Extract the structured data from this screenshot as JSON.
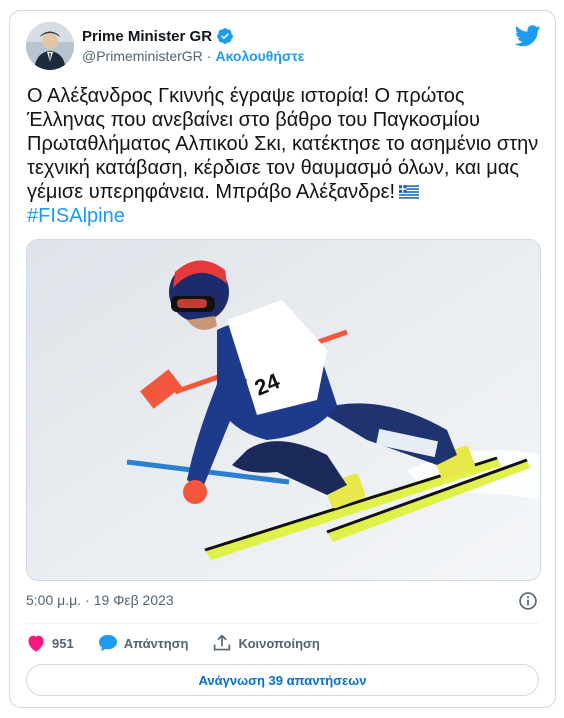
{
  "tweet": {
    "author_name": "Prime Minister GR",
    "author_handle": "@PrimeministerGR",
    "separator": "·",
    "follow_label": "Ακολουθήστε",
    "text": "Ο Αλέξανδρος Γκιννής έγραψε ιστορία! Ο πρώτος Έλληνας που ανεβαίνει στο βάθρο του Παγκοσμίου Πρωταθλήματος Αλπικού Σκι, κατέκτησε το ασημένιο στην τεχνική κατάβαση, κέρδισε τον θαυμασμό όλων, και μας γέμισε υπερηφάνεια. Μπράβο Αλέξανδρε!",
    "hashtag": "#FISAlpine",
    "time": "5:00 μ.μ.",
    "date": "19 Φεβ 2023",
    "photo_description_icon": "photo",
    "bib_number": "24"
  },
  "actions": {
    "like_count": "951",
    "reply_label": "Απάντηση",
    "share_label": "Κοινοποίηση"
  },
  "footer": {
    "read_replies_label": "Ανάγνωση 39 απαντήσεων"
  },
  "icons": {
    "verified": "verified-badge-icon",
    "twitter": "twitter-bird-icon",
    "info": "info-icon",
    "like": "heart-icon",
    "reply": "speech-bubble-icon",
    "share": "share-icon",
    "flag": "greek-flag-icon"
  },
  "colors": {
    "accent": "#1d9bf0",
    "like": "#f91880",
    "text": "#0f1419",
    "muted": "#536471"
  }
}
